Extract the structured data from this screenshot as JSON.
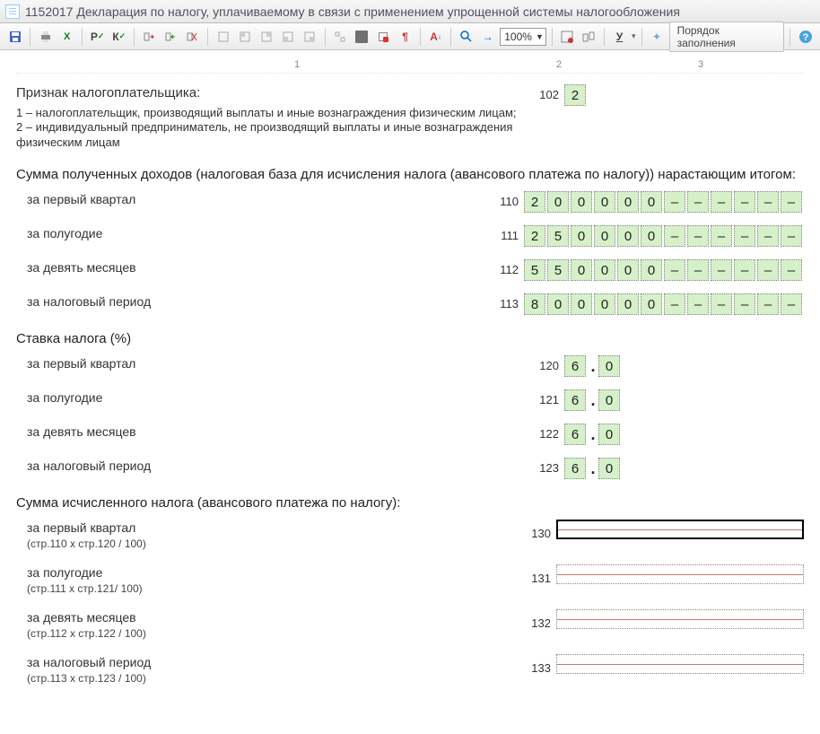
{
  "titlebar": {
    "doc_code": "1152017",
    "title": "Декларация по налогу, уплачиваемому в связи с применением упрощенной системы налогообложения"
  },
  "toolbar": {
    "zoom": "100%",
    "order_label": "Порядок заполнения"
  },
  "column_headers": {
    "c1": "1",
    "c2": "2",
    "c3": "3"
  },
  "taxpayer_sign": {
    "heading": "Признак налогоплательщика:",
    "line1": "1 – налогоплательщик, производящий выплаты и иные вознаграждения физическим лицам;",
    "line2": "2 – индивидуальный предприниматель, не производящий выплаты и иные вознаграждения физическим лицам",
    "code": "102",
    "value": "2"
  },
  "income": {
    "heading": "Сумма полученных доходов (налоговая база для исчисления налога (авансового платежа по налогу)) нарастающим итогом:",
    "rows": [
      {
        "label": "за первый квартал",
        "code": "110",
        "cells": [
          "2",
          "0",
          "0",
          "0",
          "0",
          "0",
          "–",
          "–",
          "–",
          "–",
          "–",
          "–"
        ]
      },
      {
        "label": "за полугодие",
        "code": "111",
        "cells": [
          "2",
          "5",
          "0",
          "0",
          "0",
          "0",
          "–",
          "–",
          "–",
          "–",
          "–",
          "–"
        ]
      },
      {
        "label": "за девять месяцев",
        "code": "112",
        "cells": [
          "5",
          "5",
          "0",
          "0",
          "0",
          "0",
          "–",
          "–",
          "–",
          "–",
          "–",
          "–"
        ]
      },
      {
        "label": "за налоговый период",
        "code": "113",
        "cells": [
          "8",
          "0",
          "0",
          "0",
          "0",
          "0",
          "–",
          "–",
          "–",
          "–",
          "–",
          "–"
        ]
      }
    ]
  },
  "rate": {
    "heading": "Ставка налога (%)",
    "rows": [
      {
        "label": "за первый квартал",
        "code": "120",
        "d1": "6",
        "d2": "0"
      },
      {
        "label": "за полугодие",
        "code": "121",
        "d1": "6",
        "d2": "0"
      },
      {
        "label": "за девять месяцев",
        "code": "122",
        "d1": "6",
        "d2": "0"
      },
      {
        "label": "за налоговый период",
        "code": "123",
        "d1": "6",
        "d2": "0"
      }
    ]
  },
  "calc": {
    "heading": "Сумма исчисленного налога (авансового платежа по налогу):",
    "rows": [
      {
        "label": "за первый квартал",
        "sub": "(стр.110 х стр.120 / 100)",
        "code": "130",
        "focused": true
      },
      {
        "label": "за полугодие",
        "sub": "(стр.111 х стр.121/ 100)",
        "code": "131",
        "focused": false
      },
      {
        "label": "за девять месяцев",
        "sub": "(стр.112 х стр.122 / 100)",
        "code": "132",
        "focused": false
      },
      {
        "label": "за налоговый период",
        "sub": "(стр.113 х стр.123 / 100)",
        "code": "133",
        "focused": false
      }
    ]
  }
}
